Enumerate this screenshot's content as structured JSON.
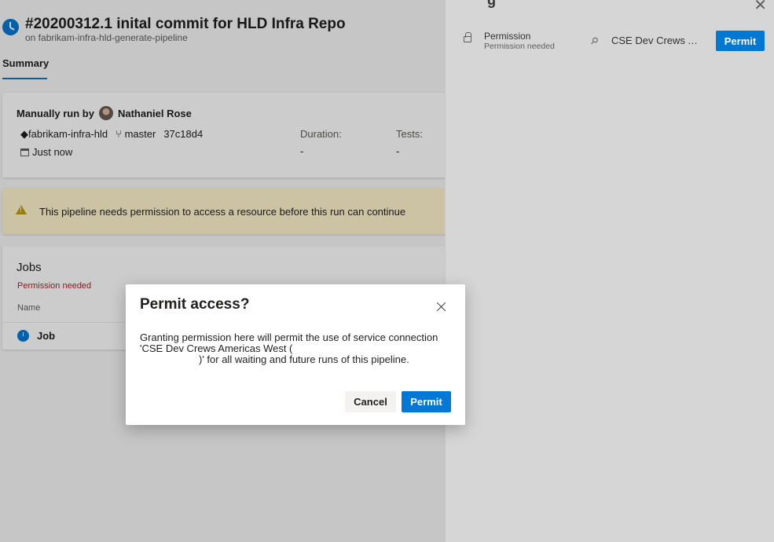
{
  "run": {
    "title": "#20200312.1 inital commit for HLD Infra Repo",
    "subtitle": "on fabrikam-infra-hld-generate-pipeline",
    "tab": "Summary"
  },
  "summary": {
    "manual_label": "Manually run by",
    "user": "Nathaniel Rose",
    "repo": "fabrikam-infra-hld",
    "branch": "master",
    "commit": "37c18d4",
    "date": "Just now",
    "duration_label": "Duration:",
    "duration_value": "-",
    "tests_label": "Tests:",
    "tests_value": "-"
  },
  "warning": {
    "text": "This pipeline needs permission to access a resource before this run can continue"
  },
  "jobs": {
    "title": "Jobs",
    "status": "Permission needed",
    "column_name": "Name",
    "job_name": "Job"
  },
  "panel": {
    "permission_label": "Permission",
    "permission_sub": "Permission needed",
    "resource": "CSE Dev Crews Americas West",
    "permit_label": "Permit",
    "close_glyph": "✕",
    "title_stub": "g"
  },
  "modal": {
    "title": "Permit access?",
    "body_line1": "Granting permission here will permit the use of service connection",
    "body_line2": "'CSE Dev Crews Americas West (",
    "body_line3": ")' for all waiting and future runs of this pipeline.",
    "cancel_label": "Cancel",
    "permit_label": "Permit"
  },
  "colors": {
    "accent": "#0078d4",
    "error": "#a4262c",
    "warning_bg": "#fff4ce"
  }
}
